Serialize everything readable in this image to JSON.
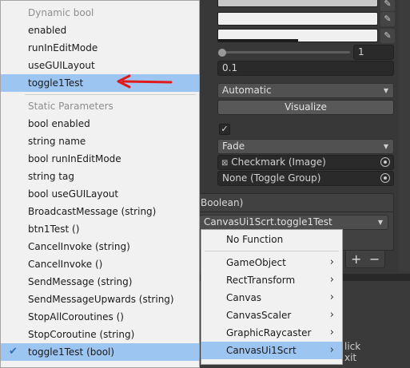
{
  "inspector": {
    "slider_value": "1",
    "float_value": "0.1",
    "navigation_value": "Automatic",
    "visualize_label": "Visualize",
    "transition_value": "Fade",
    "graphic_value": "Checkmark (Image)",
    "group_value": "None (Toggle Group)",
    "event_header": "Boolean)",
    "event_method": "CanvasUi1Scrt.toggle1Test",
    "add_label": "+",
    "remove_label": "−",
    "partial_text_1": "lick",
    "partial_text_2": "xit"
  },
  "method_menu": {
    "dynamic_header": "Dynamic bool",
    "dynamic_items": [
      "enabled",
      "runInEditMode",
      "useGUILayout",
      "toggle1Test"
    ],
    "selected_item": "toggle1Test",
    "static_header": "Static Parameters",
    "static_items": [
      "bool enabled",
      "string name",
      "bool runInEditMode",
      "string tag",
      "bool useGUILayout",
      "BroadcastMessage (string)",
      "btn1Test ()",
      "CancelInvoke (string)",
      "CancelInvoke ()",
      "SendMessage (string)",
      "SendMessageUpwards (string)",
      "StopAllCoroutines ()",
      "StopCoroutine (string)",
      "toggle1Test (bool)"
    ],
    "checked_item": "toggle1Test (bool)"
  },
  "component_menu": {
    "items": [
      "No Function",
      "GameObject",
      "RectTransform",
      "Canvas",
      "CanvasScaler",
      "GraphicRaycaster",
      "CanvasUi1Scrt"
    ],
    "selected": "CanvasUi1Scrt"
  },
  "colors": {
    "highlight": "#9cc5f2",
    "arrow": "#e01b1b"
  }
}
